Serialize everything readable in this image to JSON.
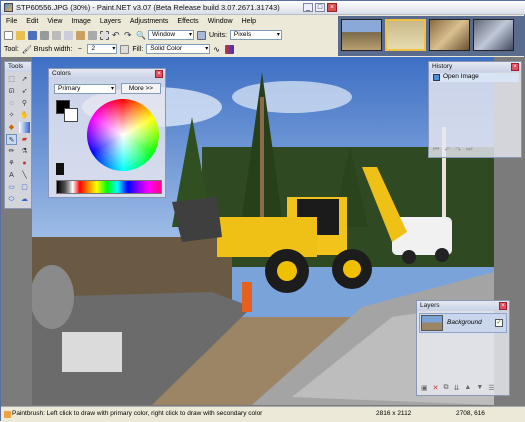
{
  "window": {
    "title": "STP60556.JPG (30%) - Paint.NET v3.07 (Beta Release build 3.07.2671.31743)",
    "minimize": "_",
    "maximize": "□",
    "close": "×"
  },
  "menu": [
    "File",
    "Edit",
    "View",
    "Image",
    "Layers",
    "Adjustments",
    "Effects",
    "Window",
    "Help"
  ],
  "toolbar1": {
    "zoom_value": "Window",
    "units_label": "Units:",
    "units_value": "Pixels"
  },
  "toolbar2": {
    "tool_label": "Tool:",
    "brush_label": "Brush width:",
    "brush_value": "2",
    "fill_label": "Fill:",
    "fill_value": "Solid Color"
  },
  "thumbnails": {
    "count": 4,
    "active_index": 1
  },
  "tools_panel": {
    "title": "Tools",
    "close": "×"
  },
  "colors_panel": {
    "title": "Colors",
    "close": "×",
    "mode_value": "Primary",
    "more_button": "More >>"
  },
  "history_panel": {
    "title": "History",
    "close": "×",
    "items": [
      "Open Image"
    ]
  },
  "layers_panel": {
    "title": "Layers",
    "close": "×",
    "layer_name": "Background",
    "layer_visible": true
  },
  "status": {
    "message": "Paintbrush: Left click to draw with primary color, right click to draw with secondary color",
    "image_size": "2816 x 2112",
    "cursor": "2708, 616"
  },
  "colors": {
    "accent": "#3a6ea5",
    "primary": "#000000",
    "secondary": "#ffffff"
  }
}
